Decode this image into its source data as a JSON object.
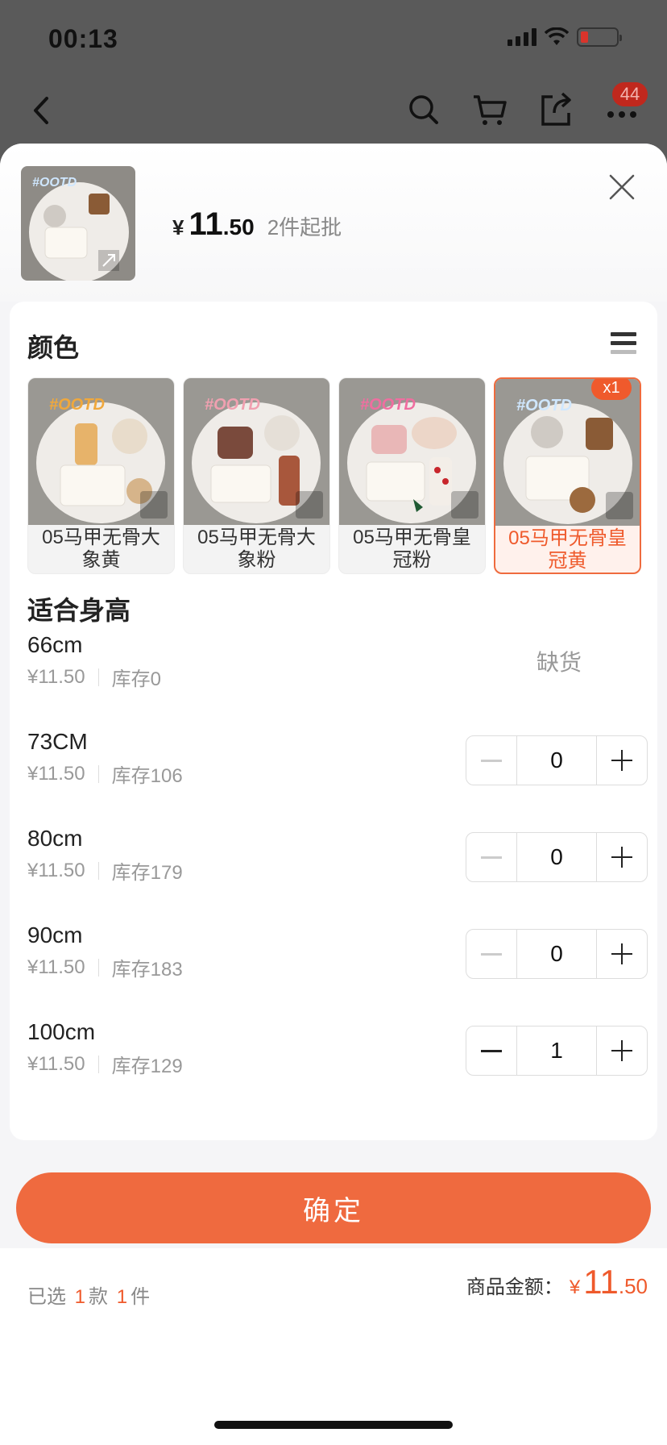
{
  "status": {
    "time": "00:13"
  },
  "nav": {
    "cart_badge": "44"
  },
  "product": {
    "price_symbol": "¥",
    "price_int": "11",
    "price_dec": ".50",
    "moq": "2件起批",
    "thumb_tag": "#OOTD"
  },
  "color_section": {
    "title": "颜色",
    "options": [
      {
        "label": "05马甲无骨大象黄",
        "tag": "#OOTD",
        "qty_badge": ""
      },
      {
        "label": "05马甲无骨大象粉",
        "tag": "#OOTD",
        "qty_badge": ""
      },
      {
        "label": "05马甲无骨皇冠粉",
        "tag": "#OOTD",
        "qty_badge": ""
      },
      {
        "label": "05马甲无骨皇冠黄",
        "tag": "#OOTD",
        "qty_badge": "x1"
      }
    ]
  },
  "size_section": {
    "title": "适合身高",
    "sizes": [
      {
        "name": "66cm",
        "price": "¥11.50",
        "stock": "库存0",
        "status": "缺货",
        "qty": ""
      },
      {
        "name": "73CM",
        "price": "¥11.50",
        "stock": "库存106",
        "status": "",
        "qty": "0"
      },
      {
        "name": "80cm",
        "price": "¥11.50",
        "stock": "库存179",
        "status": "",
        "qty": "0"
      },
      {
        "name": "90cm",
        "price": "¥11.50",
        "stock": "库存183",
        "status": "",
        "qty": "0"
      },
      {
        "name": "100cm",
        "price": "¥11.50",
        "stock": "库存129",
        "status": "",
        "qty": "1"
      }
    ]
  },
  "footer": {
    "selected_prefix": "已选",
    "kinds_count": "1",
    "kinds_unit": "款",
    "items_count": "1",
    "items_unit": "件",
    "total_label": "商品金额：",
    "total_symbol": "¥",
    "total_int": "11",
    "total_dec": ".50",
    "confirm_label": "确定"
  },
  "colors": {
    "accent": "#ef6a3f",
    "overlay": "#5a5a5a"
  }
}
